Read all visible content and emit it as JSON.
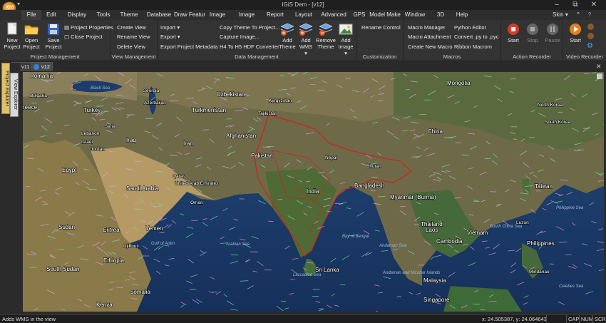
{
  "app": {
    "title": "IGiS Dem - [v12]",
    "logo_text": "IGiS"
  },
  "menu": {
    "items": [
      "File",
      "Edit",
      "Display",
      "Tools",
      "Theme",
      "Database",
      "Draw Featur",
      "Image",
      "Image Proce",
      "Report",
      "Layout",
      "Advanced M",
      "GPS",
      "Model Make",
      "Window",
      "3D",
      "Help"
    ],
    "skin": "Skin"
  },
  "ribbon": {
    "project_management": {
      "label": "Project Management",
      "new": "New\nProject",
      "open": "Open\nProject",
      "save": "Save\nProject",
      "properties": "Project Properties",
      "close": "Close Project"
    },
    "view_management": {
      "label": "View Management",
      "create": "Create View",
      "rename": "Rename View",
      "delete": "Delete View"
    },
    "data_management": {
      "label": "Data Management",
      "import": "Import",
      "export": "Export",
      "export_metadata": "Export Project Metadata",
      "copy_theme": "Copy Theme To Project...",
      "capture": "Capture Image...",
      "h4_h5": "H4 To H5 HDF Converter",
      "add_theme": "Add\nTheme",
      "add_wms": "Add\nWMS",
      "remove_theme": "Remove\nTheme",
      "add_image": "Add\nImage"
    },
    "customization": {
      "label": "Customization",
      "rename_control": "Rename Control"
    },
    "macros": {
      "label": "Macros",
      "manager": "Macro Manager",
      "attachment": "Macro Attachment",
      "create": "Create New Macro",
      "python": "Python Editor",
      "convert": "Convert .py to .pyc",
      "ribbon_macro": "Ribbon Macrom"
    },
    "action_recorder": {
      "label": "Action Recorder",
      "start": "Start",
      "stop": "Stop",
      "pause": "Pause"
    },
    "video_recorder": {
      "label": "Video Recorder",
      "start": "Start"
    }
  },
  "views": {
    "tabs": [
      "v11",
      "v12"
    ],
    "active": "v12"
  },
  "side_panels": [
    "Project Explorer",
    "View Explorer"
  ],
  "map": {
    "labels": [
      {
        "t": "Romania",
        "c": "lab"
      },
      {
        "t": "Black Sea",
        "c": "sea"
      },
      {
        "t": "Georgia",
        "c": "lab sm"
      },
      {
        "t": "Uzbekistan",
        "c": "lab"
      },
      {
        "t": "Kyrgyzstan",
        "c": "lab sm"
      },
      {
        "t": "Bulgaria",
        "c": "lab sm"
      },
      {
        "t": "Azerbaijan",
        "c": "lab sm"
      },
      {
        "t": "Turkmenistan",
        "c": "lab"
      },
      {
        "t": "Tajikistan",
        "c": "lab sm"
      },
      {
        "t": "reece",
        "c": "lab"
      },
      {
        "t": "Turkey",
        "c": "lab"
      },
      {
        "t": "Syria",
        "c": "lab sm"
      },
      {
        "t": "Lebanon",
        "c": "lab sm"
      },
      {
        "t": "Israel",
        "c": "lab sm"
      },
      {
        "t": "Jordan",
        "c": "lab sm"
      },
      {
        "t": "Iraq",
        "c": "lab"
      },
      {
        "t": "Iran",
        "c": "lab"
      },
      {
        "t": "Afghanistan",
        "c": "lab"
      },
      {
        "t": "Pakistan",
        "c": "lab"
      },
      {
        "t": "Nepal",
        "c": "lab sm"
      },
      {
        "t": "Bhutan",
        "c": "lab sm"
      },
      {
        "t": "Egypt",
        "c": "lab"
      },
      {
        "t": "Saudi Arabia",
        "c": "lab"
      },
      {
        "t": "Qatar",
        "c": "lab sm"
      },
      {
        "t": "United Arab Emirates",
        "c": "lab sm"
      },
      {
        "t": "Oman",
        "c": "lab sm"
      },
      {
        "t": "India",
        "c": "lab"
      },
      {
        "t": "Bangladesh",
        "c": "lab"
      },
      {
        "t": "Myanmar (Burma)",
        "c": "lab"
      },
      {
        "t": "Laos",
        "c": "lab"
      },
      {
        "t": "Thailand",
        "c": "lab"
      },
      {
        "t": "Vietnam",
        "c": "lab"
      },
      {
        "t": "Cambodia",
        "c": "lab"
      },
      {
        "t": "China",
        "c": "lab"
      },
      {
        "t": "Mongolia",
        "c": "lab"
      },
      {
        "t": "North Korea",
        "c": "lab sm"
      },
      {
        "t": "South Korea",
        "c": "lab sm"
      },
      {
        "t": "Taiwan",
        "c": "lab"
      },
      {
        "t": "Philippines",
        "c": "lab"
      },
      {
        "t": "Philippine Sea",
        "c": "sea"
      },
      {
        "t": "South China Sea",
        "c": "sea"
      },
      {
        "t": "Sudan",
        "c": "lab"
      },
      {
        "t": "Eritrea",
        "c": "lab"
      },
      {
        "t": "Yemen",
        "c": "lab"
      },
      {
        "t": "Djibouti",
        "c": "lab sm"
      },
      {
        "t": "Gulf of Aden",
        "c": "sea"
      },
      {
        "t": "Ethiopia",
        "c": "lab"
      },
      {
        "t": "South Sudan",
        "c": "lab"
      },
      {
        "t": "Somalia",
        "c": "lab"
      },
      {
        "t": "Kenya",
        "c": "lab"
      },
      {
        "t": "Arabian Sea",
        "c": "sea"
      },
      {
        "t": "Bay of Bengal",
        "c": "sea"
      },
      {
        "t": "Andaman Sea",
        "c": "sea"
      },
      {
        "t": "Sri Lanka",
        "c": "lab"
      },
      {
        "t": "Laccadive Sea",
        "c": "sea"
      },
      {
        "t": "Malaysia",
        "c": "lab"
      },
      {
        "t": "Singapore",
        "c": "lab"
      },
      {
        "t": "Celebes Sea",
        "c": "sea"
      },
      {
        "t": "Luzon",
        "c": "lab sm"
      },
      {
        "t": "Mindanao",
        "c": "lab sm"
      },
      {
        "t": "Andaman and Nicobar Islands",
        "c": "sea"
      }
    ]
  },
  "status": {
    "message": "Adds WMS in the view",
    "coords": "x: 24.505387,  y: 24.064643",
    "cap": "CAP",
    "num": "NUM",
    "scrl": "SCRL"
  },
  "colors": {
    "accent": "#e8a13a",
    "file_tab": "#3c3c3c",
    "sea": "#1d3a68",
    "border_red": "#d02020",
    "arrow_pink": "#e6a0e6",
    "arrow_green": "#6fe8a8"
  }
}
